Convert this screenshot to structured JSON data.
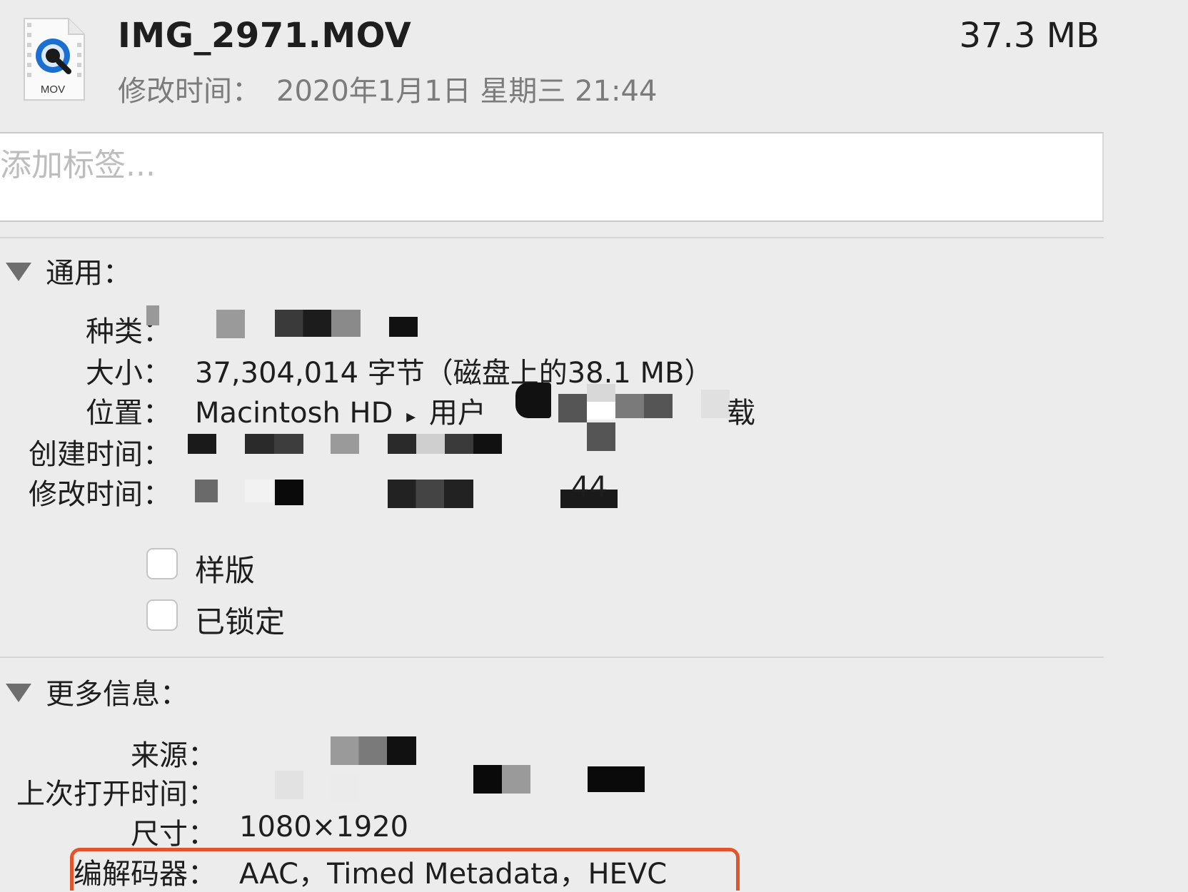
{
  "header": {
    "file_name": "IMG_2971.MOV",
    "file_size": "37.3 MB",
    "modified_label": "修改时间：",
    "modified_value": "2020年1月1日 星期三 21:44",
    "icon_badge": "MOV",
    "icon_name": "quicktime-movie-file-icon"
  },
  "tags": {
    "placeholder": "添加标签..."
  },
  "general": {
    "title": "通用：",
    "kind_label": "种类：",
    "size_label": "大小：",
    "size_value": "37,304,014 字节（磁盘上的38.1 MB）",
    "location_label": "位置：",
    "location_value_start": "Macintosh HD",
    "location_separator": "▸",
    "location_value_user": "用户",
    "location_value_end": "载",
    "created_label": "创建时间：",
    "modified_label": "修改时间：",
    "modified_value_tail": "44",
    "stationery_label": "样版",
    "locked_label": "已锁定",
    "stationery_checked": false,
    "locked_checked": false
  },
  "more_info": {
    "title": "更多信息：",
    "source_label": "来源：",
    "last_opened_label": "上次打开时间：",
    "dimensions_label": "尺寸：",
    "dimensions_value": "1080×1920",
    "codecs_label": "编解码器：",
    "codecs_value": "AAC，Timed Metadata，HEVC"
  },
  "colors": {
    "background": "#ececec",
    "highlight": "#e2542c",
    "secondary_text": "#7b7b7b"
  }
}
